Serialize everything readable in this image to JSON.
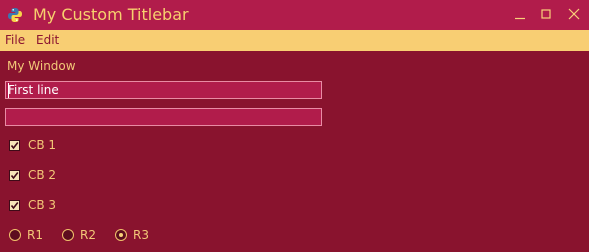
{
  "window": {
    "title": "My Custom Titlebar",
    "label": "My Window"
  },
  "menu": {
    "file": "File",
    "edit": "Edit"
  },
  "fields": [
    {
      "value": "First line"
    },
    {
      "value": ""
    }
  ],
  "checkboxes": [
    {
      "label": "CB 1",
      "checked": true
    },
    {
      "label": "CB 2",
      "checked": true
    },
    {
      "label": "CB 3",
      "checked": true
    }
  ],
  "radios": [
    {
      "label": "R1",
      "selected": false
    },
    {
      "label": "R2",
      "selected": false
    },
    {
      "label": "R3",
      "selected": true
    }
  ],
  "colors": {
    "background": "#89132e",
    "titlebar": "#b11c4b",
    "menubar": "#f8ce73",
    "accent_text": "#f5cd6c"
  }
}
